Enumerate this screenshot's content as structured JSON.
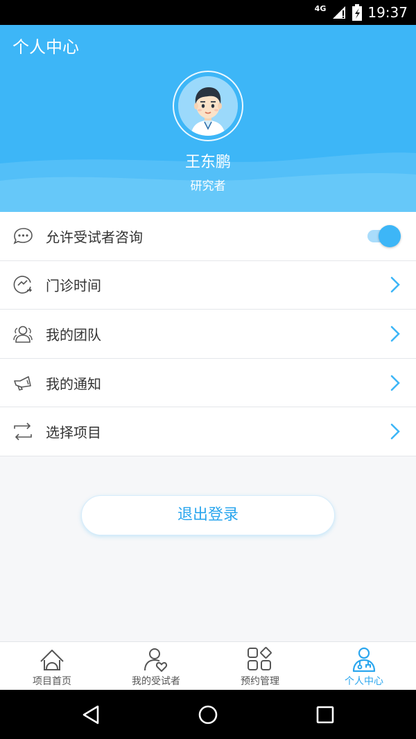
{
  "status_bar": {
    "network": "4G",
    "time": "19:37"
  },
  "header": {
    "title": "个人中心",
    "user_name": "王东鹏",
    "user_role": "研究者"
  },
  "colors": {
    "primary": "#3db6f7",
    "accent_text": "#2aa6ee"
  },
  "menu": {
    "items": [
      {
        "label": "允许受试者咨询",
        "icon": "chat-icon",
        "control": "toggle",
        "toggle_on": true
      },
      {
        "label": "门诊时间",
        "icon": "clock-icon",
        "control": "chevron"
      },
      {
        "label": "我的团队",
        "icon": "team-icon",
        "control": "chevron"
      },
      {
        "label": "我的通知",
        "icon": "megaphone-icon",
        "control": "chevron"
      },
      {
        "label": "选择项目",
        "icon": "switch-icon",
        "control": "chevron"
      }
    ]
  },
  "logout_label": "退出登录",
  "tabs": [
    {
      "label": "项目首页",
      "icon": "home-icon",
      "active": false
    },
    {
      "label": "我的受试者",
      "icon": "subjects-icon",
      "active": false
    },
    {
      "label": "预约管理",
      "icon": "grid-icon",
      "active": false
    },
    {
      "label": "个人中心",
      "icon": "profile-icon",
      "active": true
    }
  ]
}
